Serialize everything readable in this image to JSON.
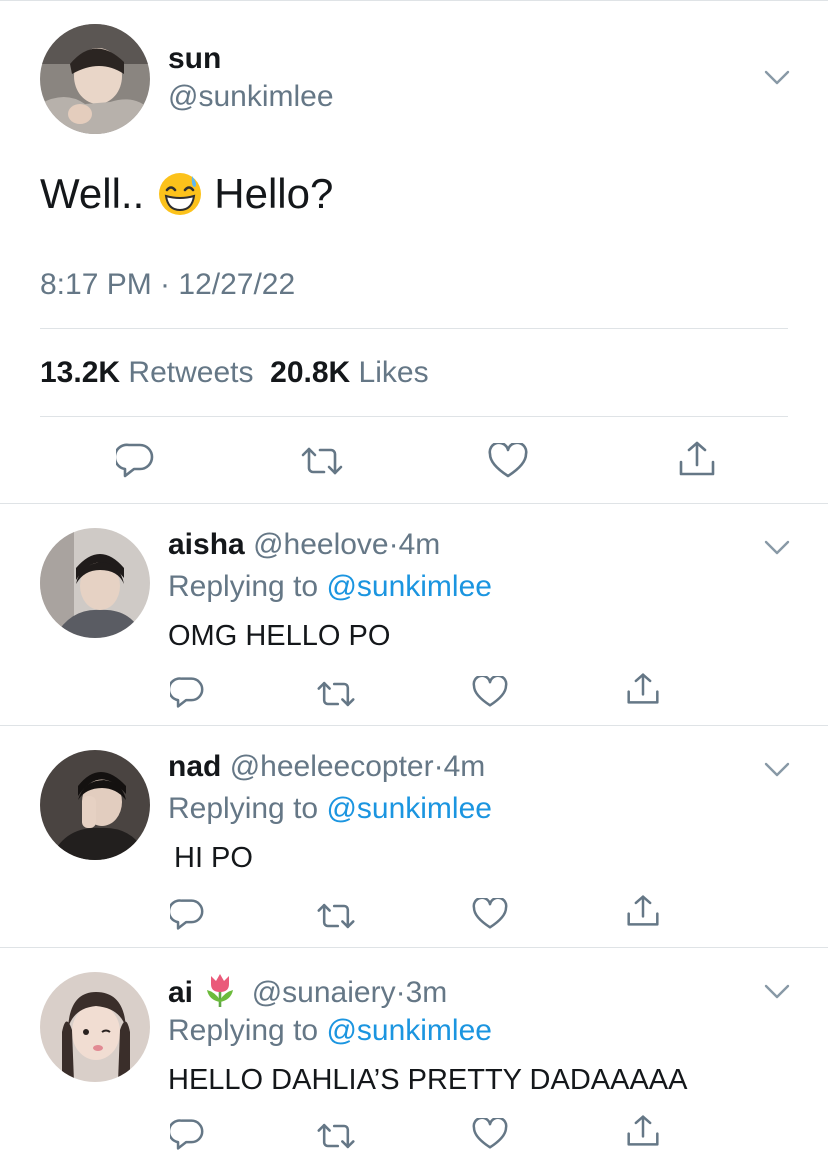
{
  "main_tweet": {
    "name": "sun",
    "handle": "@sunkimlee",
    "text_before": "Well..",
    "text_after": "Hello?",
    "emoji": "grinning-face-with-sweat-emoji",
    "timestamp": "8:17 PM · 12/27/22",
    "retweets_count": "13.2K",
    "retweets_label": "Retweets",
    "likes_count": "20.8K",
    "likes_label": "Likes"
  },
  "replies": [
    {
      "name": "aisha",
      "handle": "@heelove",
      "dot": "·",
      "time": "4m",
      "replying_prefix": "Replying to",
      "replying_to": "@sunkimlee",
      "text": "OMG HELLO PO"
    },
    {
      "name": "nad",
      "handle": "@heeleecopter",
      "dot": "·",
      "time": "4m",
      "replying_prefix": "Replying to",
      "replying_to": "@sunkimlee",
      "text": "HI PO"
    },
    {
      "name": "ai",
      "name_emoji": "tulip-emoji",
      "handle": "@sunaiery",
      "dot": "·",
      "time": "3m",
      "replying_prefix": "Replying to",
      "replying_to": "@sunkimlee",
      "text": "HELLO DAHLIA’S PRETTY DADAAAAA"
    }
  ],
  "icons": [
    "reply-icon",
    "retweet-icon",
    "like-icon",
    "share-icon",
    "chevron-down-icon"
  ],
  "colors": {
    "text": "#14171a",
    "secondary": "#657786",
    "link": "#1b95e0",
    "divider": "#dfe3e6"
  }
}
